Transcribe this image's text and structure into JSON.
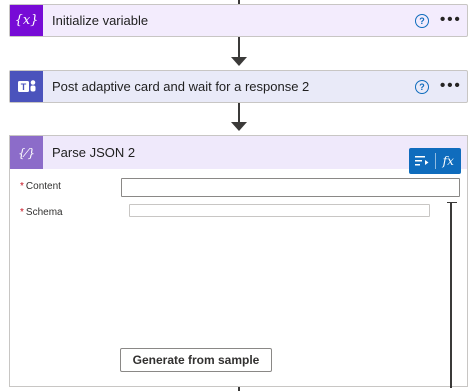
{
  "steps": [
    {
      "title": "Initialize variable",
      "icon": "curly-braces-x-icon",
      "color": "#770bd6"
    },
    {
      "title": "Post adaptive card and wait for a response 2",
      "icon": "teams-icon",
      "color": "#4b53bc"
    },
    {
      "title": "Parse JSON 2",
      "icon": "curly-braces-icon",
      "color": "#8c6cc9"
    }
  ],
  "help_glyph": "?",
  "more_glyph": "•••",
  "parse_json": {
    "fields": [
      {
        "label": "Content",
        "required_mark": "*"
      },
      {
        "label": "Schema",
        "required_mark": "*"
      }
    ],
    "generate_button": "Generate from sample"
  },
  "popover": {
    "expression_label": "fx"
  }
}
